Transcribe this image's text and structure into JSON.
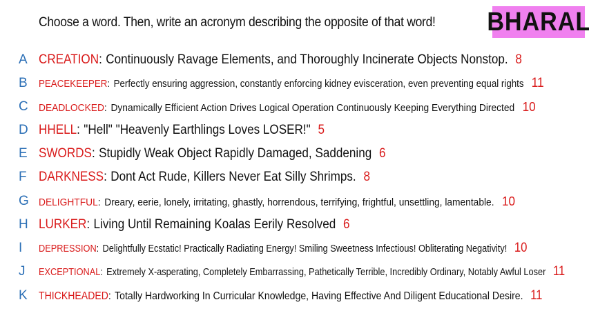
{
  "header": {
    "prompt": "Choose a word. Then, write an acronym describing the opposite of that word!",
    "name": "BHARAL"
  },
  "items": [
    {
      "letter": "A",
      "word": "CREATION",
      "acronym": "Continuously Ravage Elements, and Thoroughly Incinerate Objects Nonstop.",
      "count": "8"
    },
    {
      "letter": "B",
      "word": "PEACEKEEPER",
      "acronym": "Perfectly ensuring aggression, constantly enforcing kidney evisceration, even preventing equal rights",
      "count": "11"
    },
    {
      "letter": "C",
      "word": "DEADLOCKED",
      "acronym": "Dynamically Efficient Action Drives Logical Operation Continuously Keeping Everything Directed",
      "count": "10"
    },
    {
      "letter": "D",
      "word": "HHELL",
      "acronym": "\"Hell\" \"Heavenly Earthlings Loves LOSER!\"",
      "count": "5"
    },
    {
      "letter": "E",
      "word": "SWORDS",
      "acronym": "Stupidly Weak Object Rapidly Damaged, Saddening",
      "count": "6"
    },
    {
      "letter": "F",
      "word": "DARKNESS",
      "acronym": "Dont Act Rude, Killers Never Eat Silly Shrimps.",
      "count": "8"
    },
    {
      "letter": "G",
      "word": "DELIGHTFUL",
      "acronym": "Dreary, eerie, lonely, irritating, ghastly, horrendous, terrifying, frightful, unsettling, lamentable.",
      "count": "10"
    },
    {
      "letter": "H",
      "word": "LURKER",
      "acronym": "Living Until Remaining Koalas Eerily Resolved",
      "count": "6"
    },
    {
      "letter": "I",
      "word": "DEPRESSION",
      "acronym": "Delightfully Ecstatic! Practically Radiating Energy! Smiling Sweetness Infectious! Obliterating Negativity!",
      "count": "10"
    },
    {
      "letter": "J",
      "word": "EXCEPTIONAL",
      "acronym": "Extremely X-asperating, Completely Embarrassing, Pathetically Terrible, Incredibly Ordinary, Notably Awful Loser",
      "count": "11"
    },
    {
      "letter": "K",
      "word": "THICKHEADED",
      "acronym": "Totally Hardworking In Curricular Knowledge, Having Effective And Diligent Educational Desire.",
      "count": "11"
    }
  ]
}
